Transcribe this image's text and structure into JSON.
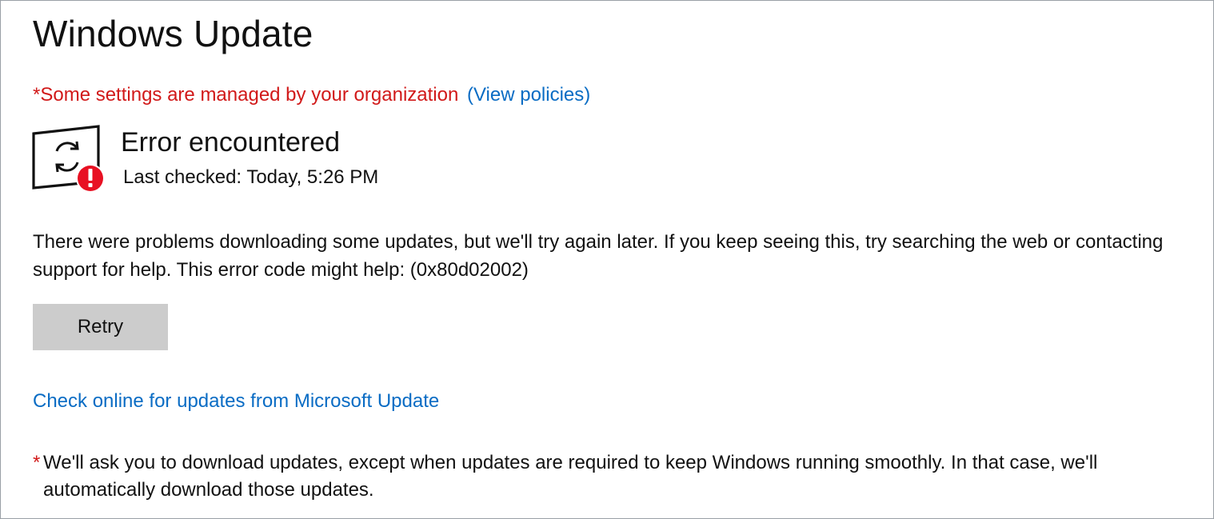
{
  "header": {
    "title": "Windows Update"
  },
  "policy_notice": {
    "text": "*Some settings are managed by your organization",
    "link_label": "(View policies)"
  },
  "status": {
    "icon": "sync-error-icon",
    "title": "Error encountered",
    "last_checked": "Last checked: Today, 5:26 PM"
  },
  "message": {
    "text": "There were problems downloading some updates, but we'll try again later. If you keep seeing this, try searching the web or contacting support for help. This error code might help: (0x80d02002)"
  },
  "actions": {
    "retry_label": "Retry",
    "check_online_label": "Check online for updates from Microsoft Update"
  },
  "footnote": {
    "asterisk": "*",
    "text": "We'll ask you to download updates, except when updates are required to keep Windows running smoothly. In that case, we'll automatically download those updates."
  },
  "colors": {
    "accent_link": "#0a6cc4",
    "warning_red": "#d11919",
    "error_badge": "#e81123",
    "button_bg": "#cccccc"
  }
}
